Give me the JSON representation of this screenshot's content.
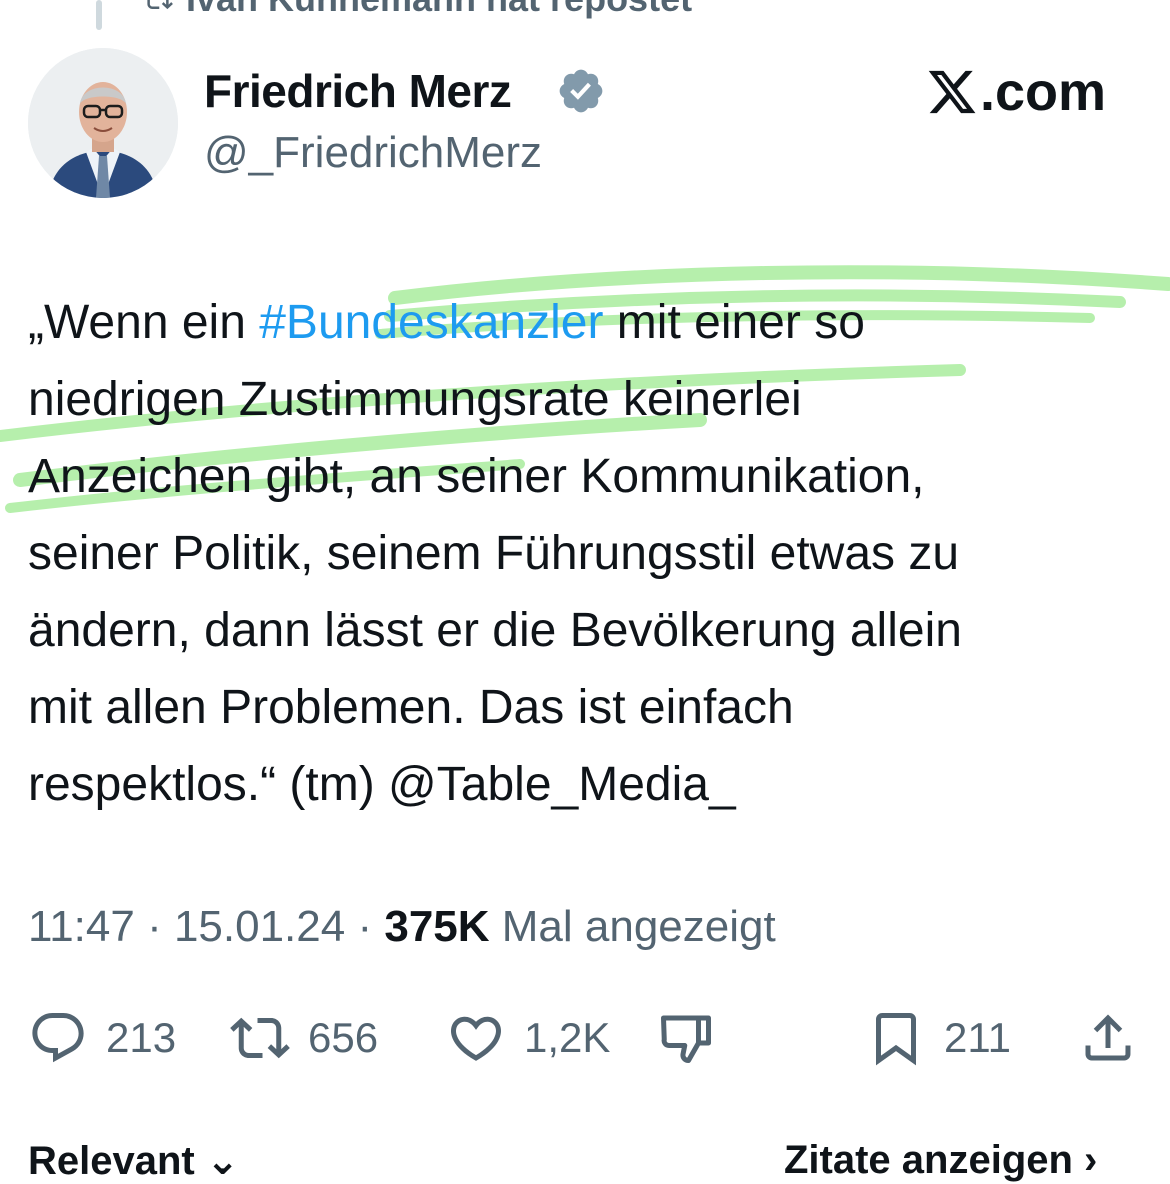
{
  "repost_banner": {
    "text": "Ivan Kühnemann hat repostet"
  },
  "author": {
    "display_name": "Friedrich Merz",
    "handle": "@_FriedrichMerz",
    "verified_icon": "verified-badge-icon"
  },
  "brand": {
    "logo_icon": "x-logo-icon",
    "label": ".com"
  },
  "tweet": {
    "lines": [
      {
        "before": "„Wenn ein ",
        "hashtag": "#Bundeskanzler",
        "after": " mit einer so"
      },
      {
        "text": "niedrigen Zustimmungsrate keinerlei"
      },
      {
        "text": "Anzeichen gibt, an seiner Kommunikation,"
      },
      {
        "text": "seiner Politik, seinem Führungsstil etwas zu"
      },
      {
        "text": "ändern, dann lässt er die Bevölkerung allein"
      },
      {
        "text": "mit allen Problemen. Das ist einfach"
      },
      {
        "text": "respektlos.“ (tm) @Table_Media_"
      }
    ],
    "highlight_color": "#7be36a"
  },
  "meta": {
    "time": "11:47",
    "separator": " · ",
    "date": "15.01.24",
    "views_count": "375K",
    "views_label": " Mal angezeigt"
  },
  "actions": {
    "reply": {
      "icon": "reply-icon",
      "count": "213"
    },
    "repost": {
      "icon": "repost-icon",
      "count": "656"
    },
    "like": {
      "icon": "heart-icon",
      "count": "1,2K"
    },
    "dislike": {
      "icon": "thumbs-down-icon"
    },
    "bookmark": {
      "icon": "bookmark-icon",
      "count": "211"
    },
    "share": {
      "icon": "share-icon"
    }
  },
  "bottom_bar": {
    "left_label": "Relevant ⌄",
    "right_label": "Zitate anzeigen ›"
  },
  "colors": {
    "text": "#0f1419",
    "secondary": "#536471",
    "link": "#1d9bf0"
  }
}
